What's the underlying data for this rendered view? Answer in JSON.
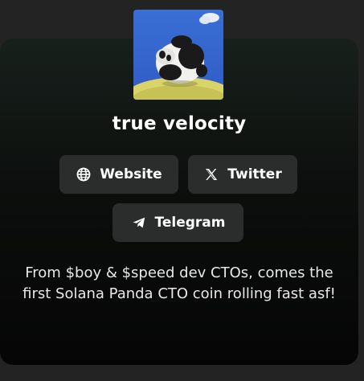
{
  "token": {
    "name": "true velocity",
    "description": "From $boy & $speed dev CTOs, comes the first Solana Panda CTO coin rolling fast asf!"
  },
  "links": [
    {
      "label": "Website",
      "icon": "globe-icon"
    },
    {
      "label": "Twitter",
      "icon": "x-icon"
    },
    {
      "label": "Telegram",
      "icon": "telegram-icon"
    }
  ],
  "colors": {
    "page_background": "#232323",
    "button_background": "#2b2d2c",
    "text": "#ffffff"
  }
}
